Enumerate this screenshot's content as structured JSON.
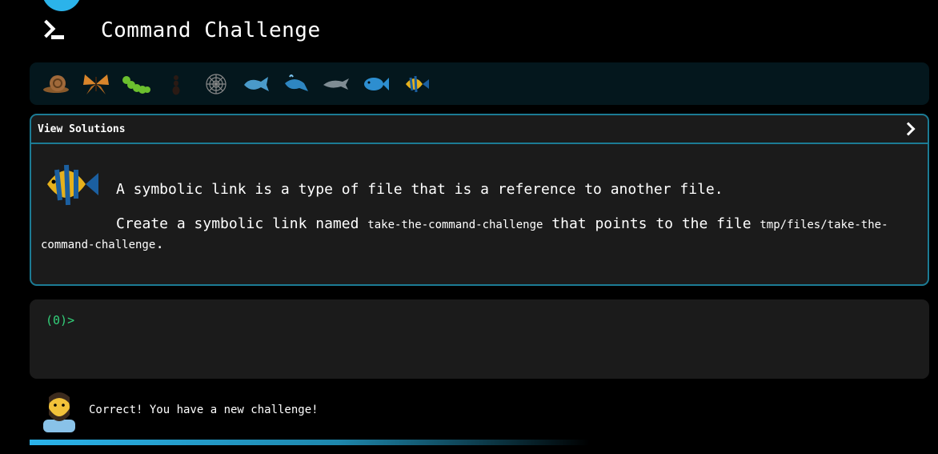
{
  "header": {
    "title": "Command Challenge"
  },
  "creatures": [
    {
      "name": "snail-icon"
    },
    {
      "name": "butterfly-icon"
    },
    {
      "name": "caterpillar-icon"
    },
    {
      "name": "ant-icon"
    },
    {
      "name": "spider-web-icon"
    },
    {
      "name": "whale-icon"
    },
    {
      "name": "spouting-whale-icon"
    },
    {
      "name": "dolphin-icon"
    },
    {
      "name": "fish-icon"
    },
    {
      "name": "tropical-fish-icon"
    }
  ],
  "panel": {
    "title": "View Solutions",
    "description": "A symbolic link is a type of file that is a reference to another file.",
    "task_prefix": "Create a symbolic link named",
    "link_name": "take-the-command-challenge",
    "task_middle": "that points to the file",
    "target_path": "tmp/files/take-the-command-challenge",
    "task_end": "."
  },
  "terminal": {
    "prompt": "(0)>"
  },
  "message": {
    "text": "Correct! You have a new challenge!"
  },
  "colors": {
    "accent": "#2bb3ea",
    "border": "#1c7b94",
    "prompt": "#33d17a",
    "panel_bg": "#1b1b1b"
  }
}
